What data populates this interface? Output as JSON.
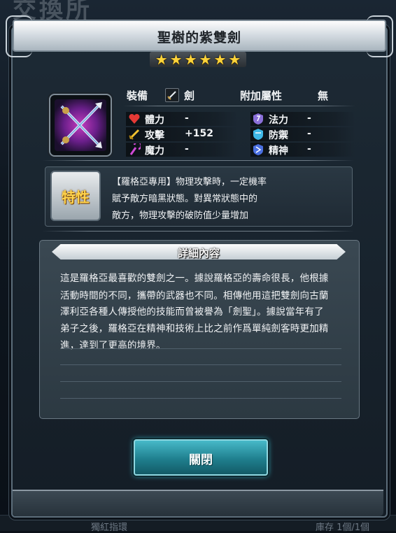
{
  "background": {
    "screen_title": "交換所",
    "bottom_left_text": "獨紅指環",
    "bottom_right_text": "庫存 1個/1個"
  },
  "dialog": {
    "title": "聖樹的紫雙劍",
    "stars": [
      "★",
      "★",
      "★",
      "★",
      "★",
      "★"
    ],
    "equip_label": "裝備",
    "equip_type": "劍",
    "bonus_attr_label": "附加屬性",
    "bonus_attr_value": "無",
    "stats_left": [
      {
        "name": "體力",
        "value": "-",
        "icon": "heart-icon",
        "color": "#e53935"
      },
      {
        "name": "攻擊",
        "value": "+152",
        "icon": "sword-icon",
        "color": "#f2c230"
      },
      {
        "name": "魔力",
        "value": "-",
        "icon": "staff-icon",
        "color": "#d04ad6"
      }
    ],
    "stats_right": [
      {
        "name": "法力",
        "value": "-",
        "icon": "magic-defense-icon",
        "color": "#8a6fd8"
      },
      {
        "name": "防禦",
        "value": "-",
        "icon": "shield-icon",
        "color": "#3fb8e6"
      },
      {
        "name": "精神",
        "value": "-",
        "icon": "spirit-icon",
        "color": "#4a6fe0"
      }
    ],
    "trait_badge": "特性",
    "trait_lines": [
      "【羅格亞專用】物理攻擊時，一定機率",
      "賦予敵方暗黑狀態。對異常狀態中的",
      "敵方，物理攻擊的破防值少量增加"
    ],
    "detail_header": "詳細內容",
    "detail_lines": [
      "這是羅格亞最喜歡的雙劍之一。據說羅格亞的壽命很長，他根據",
      "活動時間的不同，攜帶的武器也不同。相傳他用這把雙劍向古蘭",
      "澤利亞各種人傳授他的技能而曾被譽為「劍聖」。據說當年有了",
      "弟子之後，羅格亞在精神和技術上比之前作爲單純劍客時更加精",
      "進，達到了更高的境界。"
    ],
    "close_label": "關閉"
  },
  "colors": {
    "accent_cyan": "#2aa6b6",
    "gold": "#ffd43a"
  }
}
